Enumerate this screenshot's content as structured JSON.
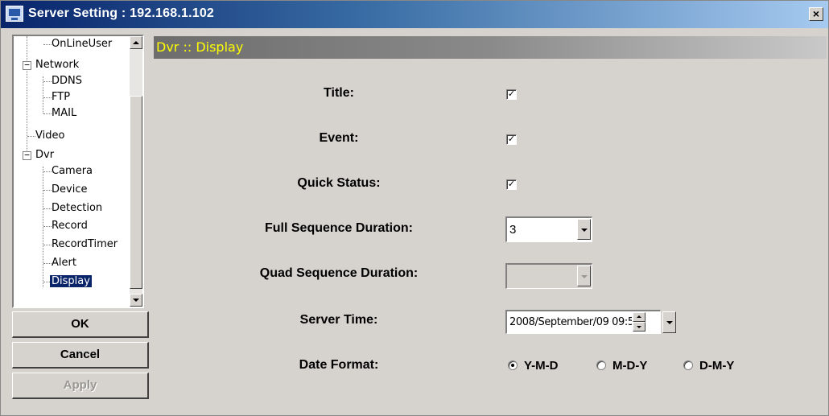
{
  "window": {
    "title": "Server Setting : 192.168.1.102",
    "close_glyph": "×"
  },
  "tree": {
    "items": [
      {
        "label": "OnLineUser"
      },
      {
        "label": "Network"
      },
      {
        "label": "DDNS"
      },
      {
        "label": "FTP"
      },
      {
        "label": "MAIL"
      },
      {
        "label": "Video"
      },
      {
        "label": "Dvr"
      },
      {
        "label": "Camera"
      },
      {
        "label": "Device"
      },
      {
        "label": "Detection"
      },
      {
        "label": "Record"
      },
      {
        "label": "RecordTimer"
      },
      {
        "label": "Alert"
      },
      {
        "label": "Display"
      }
    ],
    "expander_glyph": "−",
    "selected": "Display"
  },
  "buttons": {
    "ok": "OK",
    "cancel": "Cancel",
    "apply": "Apply"
  },
  "panel": {
    "header": "Dvr :: Display",
    "header_color": "#ffff00"
  },
  "form": {
    "title_label": "Title:",
    "title_checked": true,
    "event_label": "Event:",
    "event_checked": true,
    "quick_status_label": "Quick Status:",
    "quick_status_checked": true,
    "check_glyph": "✓",
    "full_seq_label": "Full Sequence Duration:",
    "full_seq_value": "3",
    "quad_seq_label": "Quad Sequence Duration:",
    "quad_seq_value": "",
    "server_time_label": "Server Time:",
    "server_time_value": "2008/September/09 09:5",
    "date_format_label": "Date Format:",
    "date_format_options": [
      "Y-M-D",
      "M-D-Y",
      "D-M-Y"
    ],
    "date_format_selected": "Y-M-D"
  }
}
